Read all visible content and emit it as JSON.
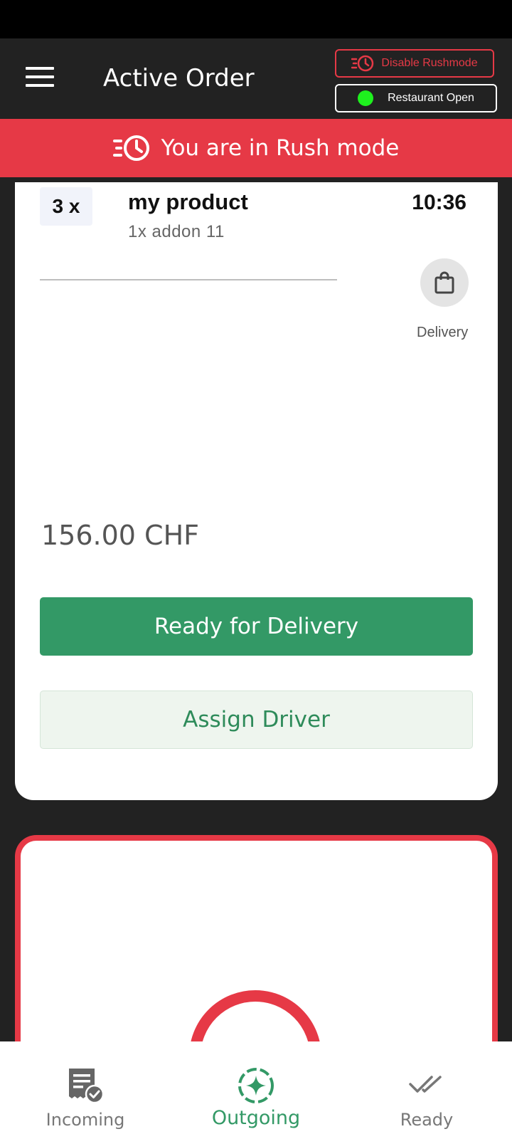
{
  "header": {
    "title": "Active Order",
    "rush_button_label": "Disable Rushmode",
    "restaurant_status_label": "Restaurant Open"
  },
  "banner": {
    "text": "You are in Rush mode"
  },
  "order": {
    "quantity": "3 x",
    "product_name": "my product",
    "addon": "1x addon 11",
    "time": "10:36",
    "order_type": "Delivery",
    "price": "156.00 CHF",
    "ready_button_label": "Ready for Delivery",
    "assign_button_label": "Assign Driver"
  },
  "nav": {
    "items": [
      {
        "label": "Incoming",
        "icon": "receipt-check-icon",
        "active": false
      },
      {
        "label": "Outgoing",
        "icon": "sparkle-circle-icon",
        "active": true
      },
      {
        "label": "Ready",
        "icon": "double-check-icon",
        "active": false
      }
    ]
  },
  "colors": {
    "accent_red": "#e63946",
    "accent_green": "#339966",
    "status_green": "#1ef01e",
    "background": "#222222"
  }
}
